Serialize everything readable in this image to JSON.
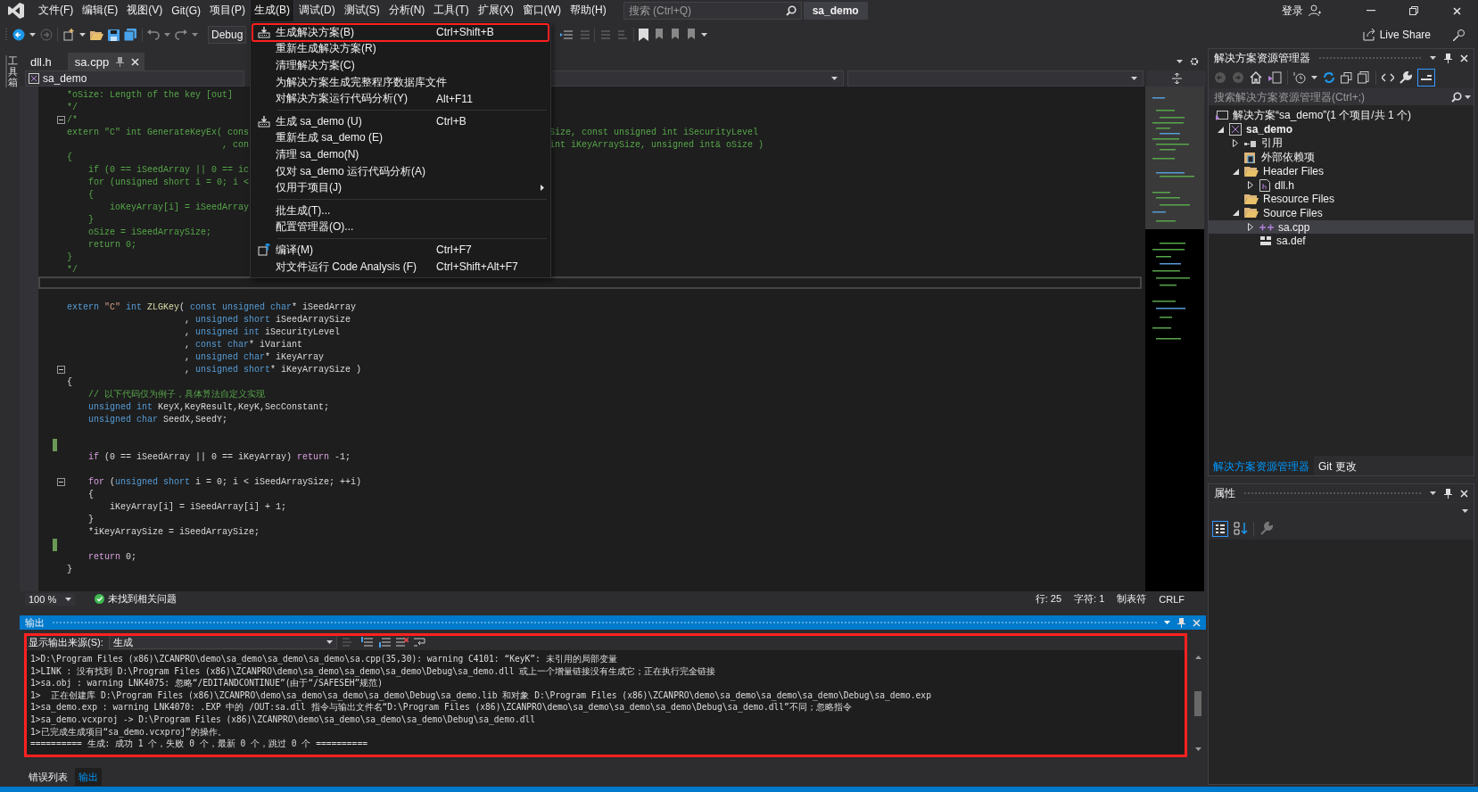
{
  "menubar": {
    "items": [
      {
        "label": "文件(F)",
        "selected": false
      },
      {
        "label": "编辑(E)",
        "selected": false
      },
      {
        "label": "视图(V)",
        "selected": false
      },
      {
        "label": "Git(G)",
        "selected": false
      },
      {
        "label": "项目(P)",
        "selected": false
      },
      {
        "label": "生成(B)",
        "selected": true
      },
      {
        "label": "调试(D)",
        "selected": false
      },
      {
        "label": "测试(S)",
        "selected": false
      },
      {
        "label": "分析(N)",
        "selected": false
      },
      {
        "label": "工具(T)",
        "selected": false
      },
      {
        "label": "扩展(X)",
        "selected": false
      },
      {
        "label": "窗口(W)",
        "selected": false
      },
      {
        "label": "帮助(H)",
        "selected": false
      }
    ]
  },
  "search": {
    "placeholder": "搜索 (Ctrl+Q)"
  },
  "solution_name": "sa_demo",
  "account": {
    "label": "登录"
  },
  "toolbar": {
    "configuration": "Debug",
    "live_share": "Live Share"
  },
  "toolbox": {
    "label": "工具箱"
  },
  "doc_tabs": [
    {
      "label": "dll.h",
      "selected": false
    },
    {
      "label": "sa.cpp",
      "selected": true
    }
  ],
  "nav_bar": {
    "project": "sa_demo"
  },
  "editor": {
    "lines": [
      {
        "kind": "code",
        "segments": [
          {
            "kind": "comment",
            "text": "*oSize: Length of the key [out]"
          }
        ]
      },
      {
        "kind": "code",
        "segments": [
          {
            "kind": "comment",
            "text": "*/"
          }
        ]
      },
      {
        "kind": "fold",
        "segments": [
          {
            "kind": "comment",
            "text": "/*"
          }
        ]
      },
      {
        "kind": "code",
        "segments": [
          {
            "kind": "comment",
            "text": "extern \"C\" int GenerateKeyEx( cons"
          }
        ],
        "after_menu": "Size, const unsigned int iSecurityLevel"
      },
      {
        "kind": "code",
        "segments": [
          {
            "kind": "comment",
            "text": "                             , con"
          }
        ],
        "after_menu": "int iKeyArraySize, unsigned int& oSize )"
      },
      {
        "kind": "code",
        "segments": [
          {
            "kind": "comment",
            "text": "{"
          }
        ]
      },
      {
        "kind": "code",
        "segments": [
          {
            "kind": "comment",
            "text": "    if (0 == iSeedArray || 0 == ic"
          }
        ]
      },
      {
        "kind": "code",
        "segments": [
          {
            "kind": "comment",
            "text": "    for (unsigned short i = 0; i <"
          }
        ]
      },
      {
        "kind": "code",
        "segments": [
          {
            "kind": "comment",
            "text": "    {"
          }
        ]
      },
      {
        "kind": "code",
        "segments": [
          {
            "kind": "comment",
            "text": "        ioKeyArray[i] = iSeedArray"
          }
        ]
      },
      {
        "kind": "code",
        "segments": [
          {
            "kind": "comment",
            "text": "    }"
          }
        ]
      },
      {
        "kind": "code",
        "segments": [
          {
            "kind": "comment",
            "text": "    oSize = iSeedArraySize;"
          }
        ]
      },
      {
        "kind": "code",
        "segments": [
          {
            "kind": "comment",
            "text": "    return 0;"
          }
        ]
      },
      {
        "kind": "code",
        "segments": [
          {
            "kind": "comment",
            "text": "}"
          }
        ]
      },
      {
        "kind": "code",
        "segments": [
          {
            "kind": "comment",
            "text": "*/"
          }
        ]
      },
      {
        "kind": "current"
      },
      {
        "kind": "code"
      },
      {
        "kind": "code",
        "segments": [
          {
            "kind": "keyword",
            "text": "extern "
          },
          {
            "kind": "string",
            "text": "\"C\""
          },
          {
            "kind": "keyword",
            "text": " int "
          },
          {
            "kind": "function",
            "text": "ZLGKey"
          },
          {
            "kind": "plain",
            "text": "( "
          },
          {
            "kind": "keyword",
            "text": "const unsigned char"
          },
          {
            "kind": "plain",
            "text": "* iSeedArray"
          }
        ]
      },
      {
        "kind": "code",
        "segments": [
          {
            "kind": "plain",
            "text": "                      , "
          },
          {
            "kind": "keyword",
            "text": "unsigned short"
          },
          {
            "kind": "plain",
            "text": " iSeedArraySize"
          }
        ]
      },
      {
        "kind": "code",
        "segments": [
          {
            "kind": "plain",
            "text": "                      , "
          },
          {
            "kind": "keyword",
            "text": "unsigned int"
          },
          {
            "kind": "plain",
            "text": " iSecurityLevel"
          }
        ]
      },
      {
        "kind": "code",
        "segments": [
          {
            "kind": "plain",
            "text": "                      , "
          },
          {
            "kind": "keyword",
            "text": "const char"
          },
          {
            "kind": "plain",
            "text": "* iVariant"
          }
        ]
      },
      {
        "kind": "code",
        "segments": [
          {
            "kind": "plain",
            "text": "                      , "
          },
          {
            "kind": "keyword",
            "text": "unsigned char"
          },
          {
            "kind": "plain",
            "text": "* iKeyArray"
          }
        ]
      },
      {
        "kind": "fold",
        "segments": [
          {
            "kind": "plain",
            "text": "                      , "
          },
          {
            "kind": "keyword",
            "text": "unsigned short"
          },
          {
            "kind": "plain",
            "text": "* iKeyArraySize )"
          }
        ]
      },
      {
        "kind": "code",
        "segments": [
          {
            "kind": "plain",
            "text": "{"
          }
        ]
      },
      {
        "kind": "code",
        "segments": [
          {
            "kind": "comment",
            "text": "    // 以下代码仅为例子，具体算法自定义实现"
          }
        ]
      },
      {
        "kind": "code",
        "segments": [
          {
            "kind": "keyword",
            "text": "    unsigned int "
          },
          {
            "kind": "plain",
            "text": "KeyX,KeyResult,KeyK,SecConstant;"
          }
        ]
      },
      {
        "kind": "code",
        "segments": [
          {
            "kind": "keyword",
            "text": "    unsigned char "
          },
          {
            "kind": "plain",
            "text": "SeedX,SeedY;"
          }
        ]
      },
      {
        "kind": "code"
      },
      {
        "kind": "changed"
      },
      {
        "kind": "code",
        "segments": [
          {
            "kind": "control",
            "text": "    if"
          },
          {
            "kind": "plain",
            "text": " (0 == iSeedArray || 0 == iKeyArray) "
          },
          {
            "kind": "control",
            "text": "return"
          },
          {
            "kind": "plain",
            "text": " -1;"
          }
        ]
      },
      {
        "kind": "code"
      },
      {
        "kind": "fold",
        "segments": [
          {
            "kind": "control",
            "text": "    for"
          },
          {
            "kind": "plain",
            "text": " ("
          },
          {
            "kind": "keyword",
            "text": "unsigned short"
          },
          {
            "kind": "plain",
            "text": " i = 0; i < iSeedArraySize; ++i)"
          }
        ]
      },
      {
        "kind": "code",
        "segments": [
          {
            "kind": "plain",
            "text": "    {"
          }
        ]
      },
      {
        "kind": "code",
        "segments": [
          {
            "kind": "plain",
            "text": "        iKeyArray[i] = iSeedArray[i] + 1;"
          }
        ]
      },
      {
        "kind": "code",
        "segments": [
          {
            "kind": "plain",
            "text": "    }"
          }
        ]
      },
      {
        "kind": "code",
        "segments": [
          {
            "kind": "plain",
            "text": "    *iKeyArraySize = iSeedArraySize;"
          }
        ]
      },
      {
        "kind": "changed"
      },
      {
        "kind": "code",
        "segments": [
          {
            "kind": "control",
            "text": "    return"
          },
          {
            "kind": "plain",
            "text": " 0;"
          }
        ]
      },
      {
        "kind": "code",
        "segments": [
          {
            "kind": "plain",
            "text": "}"
          }
        ]
      }
    ]
  },
  "editor_status": {
    "zoom": "100 %",
    "issues": "未找到相关问题",
    "line": "行: 25",
    "column": "字符: 1",
    "indent": "制表符",
    "line_ending": "CRLF"
  },
  "output": {
    "title": "输出",
    "source_label": "显示输出来源(S):",
    "source": "生成",
    "marked": true,
    "lines": [
      "1>D:\\Program Files (x86)\\ZCANPRO\\demo\\sa_demo\\sa_demo\\sa_demo\\sa.cpp(35,30): warning C4101: “KeyK”: 未引用的局部变量",
      "1>LINK : 没有找到 D:\\Program Files (x86)\\ZCANPRO\\demo\\sa_demo\\sa_demo\\sa_demo\\Debug\\sa_demo.dll 或上一个增量链接没有生成它；正在执行完全链接",
      "1>sa.obj : warning LNK4075: 忽略“/EDITANDCONTINUE”(由于“/SAFESEH”规范)",
      "1>  正在创建库 D:\\Program Files (x86)\\ZCANPRO\\demo\\sa_demo\\sa_demo\\sa_demo\\Debug\\sa_demo.lib 和对象 D:\\Program Files (x86)\\ZCANPRO\\demo\\sa_demo\\sa_demo\\sa_demo\\Debug\\sa_demo.exp",
      "1>sa_demo.exp : warning LNK4070: .EXP 中的 /OUT:sa.dll 指令与输出文件名“D:\\Program Files (x86)\\ZCANPRO\\demo\\sa_demo\\sa_demo\\sa_demo\\Debug\\sa_demo.dll”不同；忽略指令",
      "1>sa_demo.vcxproj -> D:\\Program Files (x86)\\ZCANPRO\\demo\\sa_demo\\sa_demo\\sa_demo\\Debug\\sa_demo.dll",
      "1>已完成生成项目“sa_demo.vcxproj”的操作。",
      "========== 生成: 成功 1 个，失败 0 个，最新 0 个，跳过 0 个 =========="
    ]
  },
  "bottom_tabs": [
    {
      "label": "错误列表",
      "selected": false
    },
    {
      "label": "输出",
      "selected": true
    }
  ],
  "solution_explorer": {
    "title": "解决方案资源管理器",
    "search": {
      "placeholder": "搜索解决方案资源管理器(Ctrl+;)"
    },
    "tree": [
      {
        "label": "解决方案“sa_demo”(1 个项目/共 1 个)",
        "kind": "solution",
        "selected": false,
        "children": [
          {
            "label": "sa_demo",
            "kind": "project",
            "expanded": true,
            "selected": false,
            "children": [
              {
                "label": "引用",
                "kind": "references",
                "expanded": false,
                "selected": false
              },
              {
                "label": "外部依赖项",
                "kind": "external",
                "selected": false
              },
              {
                "label": "Header Files",
                "kind": "folder",
                "expanded": true,
                "selected": false,
                "children": [
                  {
                    "label": "dll.h",
                    "kind": "header",
                    "expanded": false,
                    "selected": false
                  }
                ]
              },
              {
                "label": "Resource Files",
                "kind": "folder",
                "selected": false
              },
              {
                "label": "Source Files",
                "kind": "folder",
                "expanded": true,
                "selected": false,
                "children": [
                  {
                    "label": "sa.cpp",
                    "kind": "cpp",
                    "expanded": false,
                    "selected": true
                  },
                  {
                    "label": "sa.def",
                    "kind": "def",
                    "selected": false
                  }
                ]
              }
            ]
          }
        ]
      }
    ]
  },
  "panel_tabs": [
    {
      "label": "解决方案资源管理器",
      "selected": true
    },
    {
      "label": "Git 更改",
      "selected": false
    }
  ],
  "properties": {
    "title": "属性"
  },
  "build_menu": {
    "items": [
      {
        "kind": "item",
        "label": "生成解决方案(B)",
        "shortcut": "Ctrl+Shift+B",
        "submenu": false,
        "marked": true
      },
      {
        "kind": "item",
        "label": "重新生成解决方案(R)",
        "submenu": false,
        "marked": false
      },
      {
        "kind": "item",
        "label": "清理解决方案(C)",
        "submenu": false,
        "marked": false
      },
      {
        "kind": "item",
        "label": "为解决方案生成完整程序数据库文件",
        "submenu": false,
        "marked": false
      },
      {
        "kind": "item",
        "label": "对解决方案运行代码分析(Y)",
        "shortcut": "Alt+F11",
        "submenu": false,
        "marked": false
      },
      {
        "kind": "separator"
      },
      {
        "kind": "item",
        "label": "生成 sa_demo (U)",
        "shortcut": "Ctrl+B",
        "submenu": false,
        "marked": false
      },
      {
        "kind": "item",
        "label": "重新生成 sa_demo (E)",
        "submenu": false,
        "marked": false
      },
      {
        "kind": "item",
        "label": "清理 sa_demo(N)",
        "submenu": false,
        "marked": false
      },
      {
        "kind": "item",
        "label": "仅对 sa_demo 运行代码分析(A)",
        "submenu": false,
        "marked": false
      },
      {
        "kind": "item",
        "label": "仅用于项目(J)",
        "submenu": true,
        "marked": false
      },
      {
        "kind": "separator"
      },
      {
        "kind": "item",
        "label": "批生成(T)...",
        "submenu": false,
        "marked": false
      },
      {
        "kind": "item",
        "label": "配置管理器(O)...",
        "submenu": false,
        "marked": false
      },
      {
        "kind": "separator"
      },
      {
        "kind": "item",
        "label": "编译(M)",
        "shortcut": "Ctrl+F7",
        "submenu": false,
        "marked": false
      },
      {
        "kind": "item",
        "label": "对文件运行 Code Analysis (F)",
        "shortcut": "Ctrl+Shift+Alt+F7",
        "submenu": false,
        "marked": false
      }
    ]
  }
}
